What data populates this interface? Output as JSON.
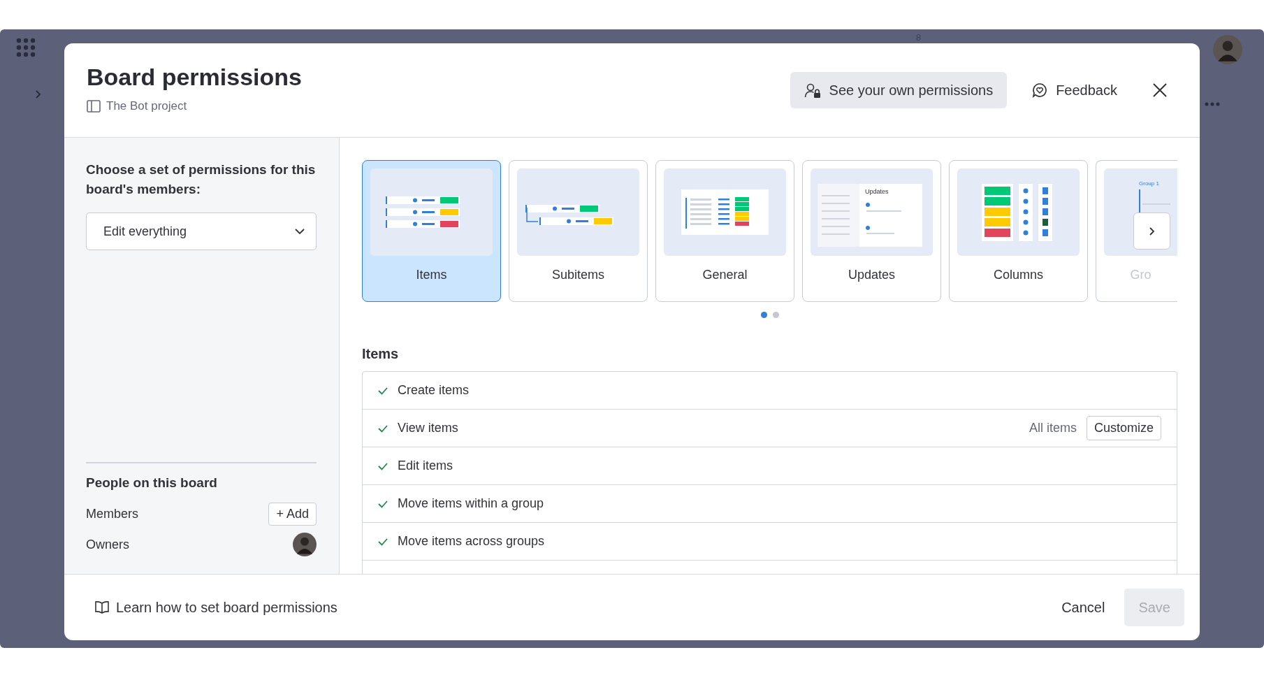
{
  "backdrop": {
    "badge": "8"
  },
  "modal": {
    "title": "Board permissions",
    "board_name": "The Bot project"
  },
  "header_actions": [
    {
      "label": "See your own permissions",
      "kind": "permissions"
    },
    {
      "label": "Feedback",
      "kind": "feedback"
    }
  ],
  "sidebar": {
    "prompt": "Choose a set of permissions for this board's members:",
    "preset": {
      "value": "Edit everything"
    },
    "people": {
      "title": "People on this board",
      "roles": [
        {
          "label": "Members",
          "kind": "add",
          "action": "+ Add"
        },
        {
          "label": "Owners",
          "kind": "avatars"
        }
      ]
    }
  },
  "categories": [
    {
      "label": "Items",
      "selected": true,
      "kind": "items"
    },
    {
      "label": "Subitems",
      "selected": false,
      "kind": "subitems"
    },
    {
      "label": "General",
      "selected": false,
      "kind": "general"
    },
    {
      "label": "Updates",
      "selected": false,
      "kind": "updates",
      "thumbnail_title": "Updates"
    },
    {
      "label": "Columns",
      "selected": false,
      "kind": "columns"
    },
    {
      "label": "Gro",
      "selected": false,
      "kind": "groups",
      "thumbnail_title": "Group 1"
    }
  ],
  "pages": [
    {
      "selected": true
    },
    {
      "selected": false
    }
  ],
  "section": {
    "title": "Items",
    "permissions": [
      {
        "label": "Create items",
        "checked": true
      },
      {
        "label": "View items",
        "checked": true,
        "scope": "All items",
        "action": "Customize"
      },
      {
        "label": "Edit items",
        "checked": true
      },
      {
        "label": "Move items within a group",
        "checked": true
      },
      {
        "label": "Move items across groups",
        "checked": true
      }
    ]
  },
  "footer": {
    "help_link": "Learn how to set board permissions",
    "cancel": "Cancel",
    "save": {
      "label": "Save",
      "disabled": true
    }
  }
}
